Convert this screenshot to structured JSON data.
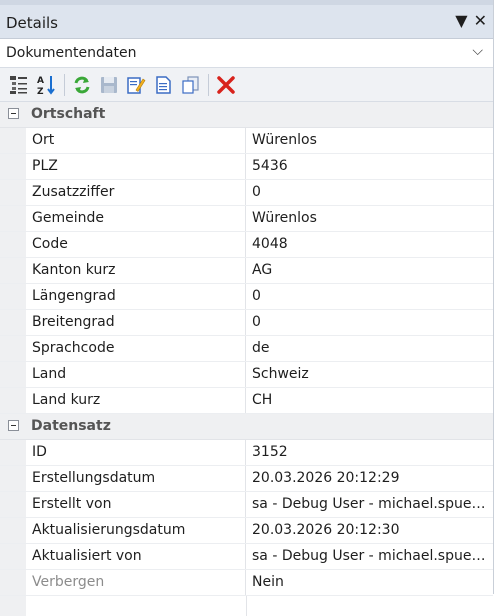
{
  "panel": {
    "title": "Details",
    "pin_glyph": "▼",
    "close_glyph": "✕"
  },
  "dropdown": {
    "value": "Dokumentendaten",
    "chevron": "⌵"
  },
  "toolbar": {
    "icons": [
      "categorize-icon",
      "sort-alpha-icon",
      "refresh-icon",
      "save-icon",
      "edit-icon",
      "document-icon",
      "copy-icon",
      "delete-icon"
    ]
  },
  "sections": [
    {
      "title": "Ortschaft",
      "rows": [
        {
          "key": "Ort",
          "value": "Würenlos"
        },
        {
          "key": "PLZ",
          "value": "5436"
        },
        {
          "key": "Zusatzziffer",
          "value": "0"
        },
        {
          "key": "Gemeinde",
          "value": "Würenlos"
        },
        {
          "key": "Code",
          "value": "4048"
        },
        {
          "key": "Kanton kurz",
          "value": "AG"
        },
        {
          "key": "Längengrad",
          "value": "0"
        },
        {
          "key": "Breitengrad",
          "value": "0"
        },
        {
          "key": "Sprachcode",
          "value": "de"
        },
        {
          "key": "Land",
          "value": "Schweiz"
        },
        {
          "key": "Land kurz",
          "value": "CH"
        }
      ]
    },
    {
      "title": "Datensatz",
      "rows": [
        {
          "key": "ID",
          "value": "3152"
        },
        {
          "key": "Erstellungsdatum",
          "value": "20.03.2026 20:12:29"
        },
        {
          "key": "Erstellt von",
          "value": "sa - Debug User - michael.spuehler"
        },
        {
          "key": "Aktualisierungsdatum",
          "value": "20.03.2026 20:12:30"
        },
        {
          "key": "Aktualisiert von",
          "value": "sa - Debug User - michael.spuehler"
        },
        {
          "key": "Verbergen",
          "value": "Nein",
          "muted": true
        }
      ]
    }
  ]
}
